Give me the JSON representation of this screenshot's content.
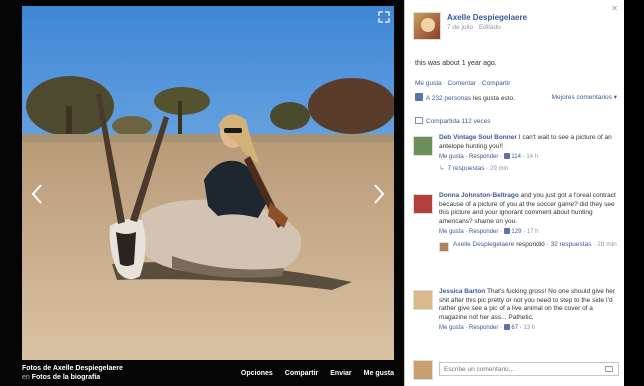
{
  "caption": {
    "photos_of": "Fotos de Axelle Despiegelaere",
    "prefix": "en",
    "album": "Fotos de la biografía",
    "actions": [
      "Opciones",
      "Compartir",
      "Enviar",
      "Me gusta"
    ]
  },
  "post": {
    "author": "Axelle Despiegelaere",
    "date": "7 de julio",
    "edited": "Editado",
    "text": "this was about 1 year ago.",
    "actions": {
      "like": "Me gusta",
      "comment": "Comentar",
      "share": "Compartir"
    },
    "likes_text_link": "A 232 personas",
    "likes_text_rest": "les gusta esto.",
    "best_comments": "Mejores comentarios",
    "shares": "Compartida 112 veces"
  },
  "comments": [
    {
      "name": "Deb Vintage Soul Bonner",
      "text": "I can't wait to see a picture of an antelope hunting you!!",
      "like": "Me gusta",
      "reply": "Responder",
      "count": "114",
      "time": "14 h",
      "replies": "7 respuestas",
      "replies_time": "29 min",
      "avatar_color": "#6b8e5a"
    },
    {
      "name": "Donna Johnston-Beltrago",
      "text": "and you just got a l'oreal contract because of a picture of you at the soccer game? did they see this picture and your ignorant comment about hunting americans? shame on you.",
      "like": "Me gusta",
      "reply": "Responder",
      "count": "129",
      "time": "17 h",
      "reply_author": "Axelle Despiegelaere",
      "reply_action": "respondió",
      "reply_count": "32 respuestas",
      "reply_time": "28 min",
      "avatar_color": "#b3403a"
    },
    {
      "name": "Jessica Barton",
      "text": "That's fucking gross! No one should give her shit after this pic pretty or not you need to step to the side I'd rather give see a pic of a live animal on the cover of a magazine not her ass... Pathetic.",
      "like": "Me gusta",
      "reply": "Responder",
      "count": "67",
      "time": "13 h",
      "avatar_color": "#d8b98a"
    }
  ],
  "write_placeholder": "Escribe un comentario...",
  "colors": {
    "link": "#3b5998",
    "muted": "#9197a3",
    "background": "#0b0b0b"
  }
}
